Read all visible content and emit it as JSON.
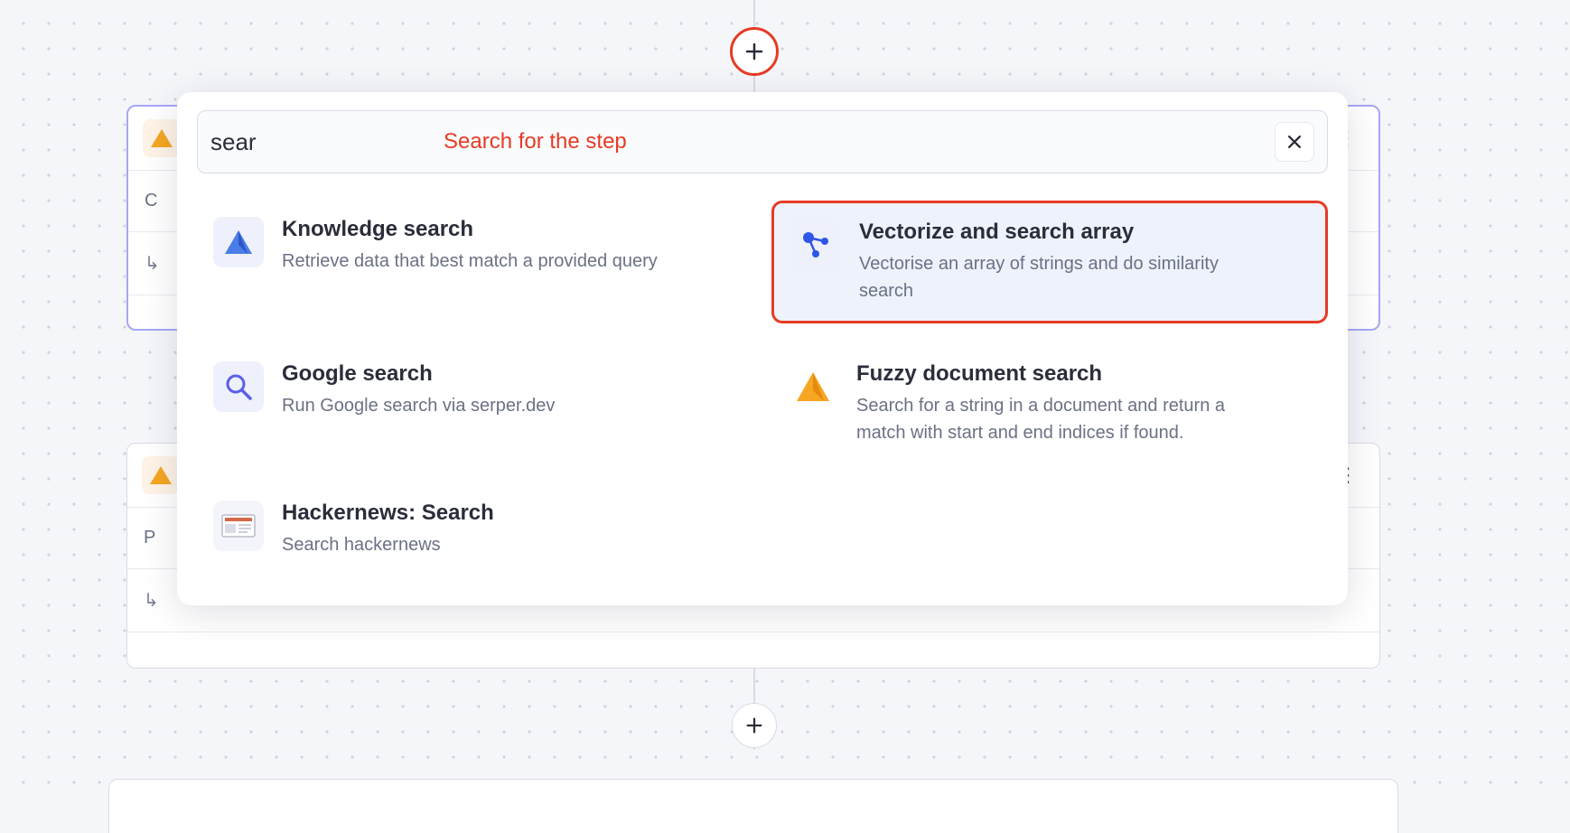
{
  "search": {
    "value": "sear",
    "hint": "Search for the step"
  },
  "bg_card1": {
    "row1_placeholder": "C",
    "row2_placeholder": ""
  },
  "bg_card2": {
    "row1_placeholder": "P"
  },
  "results": [
    {
      "title": "Knowledge search",
      "desc": "Retrieve data that best match a provided query",
      "icon": "pyramid-blue",
      "selected": false
    },
    {
      "title": "Vectorize and search array",
      "desc": "Vectorise an array of strings and do similarity search",
      "icon": "graph",
      "selected": true
    },
    {
      "title": "Google search",
      "desc": "Run Google search via serper.dev",
      "icon": "magnifier",
      "selected": false
    },
    {
      "title": "Fuzzy document search",
      "desc": "Search for a string in a document and return a match with start and end indices if found.",
      "icon": "pyramid-orange",
      "selected": false
    },
    {
      "title": "Hackernews: Search",
      "desc": "Search hackernews",
      "icon": "newspaper",
      "selected": false
    }
  ]
}
